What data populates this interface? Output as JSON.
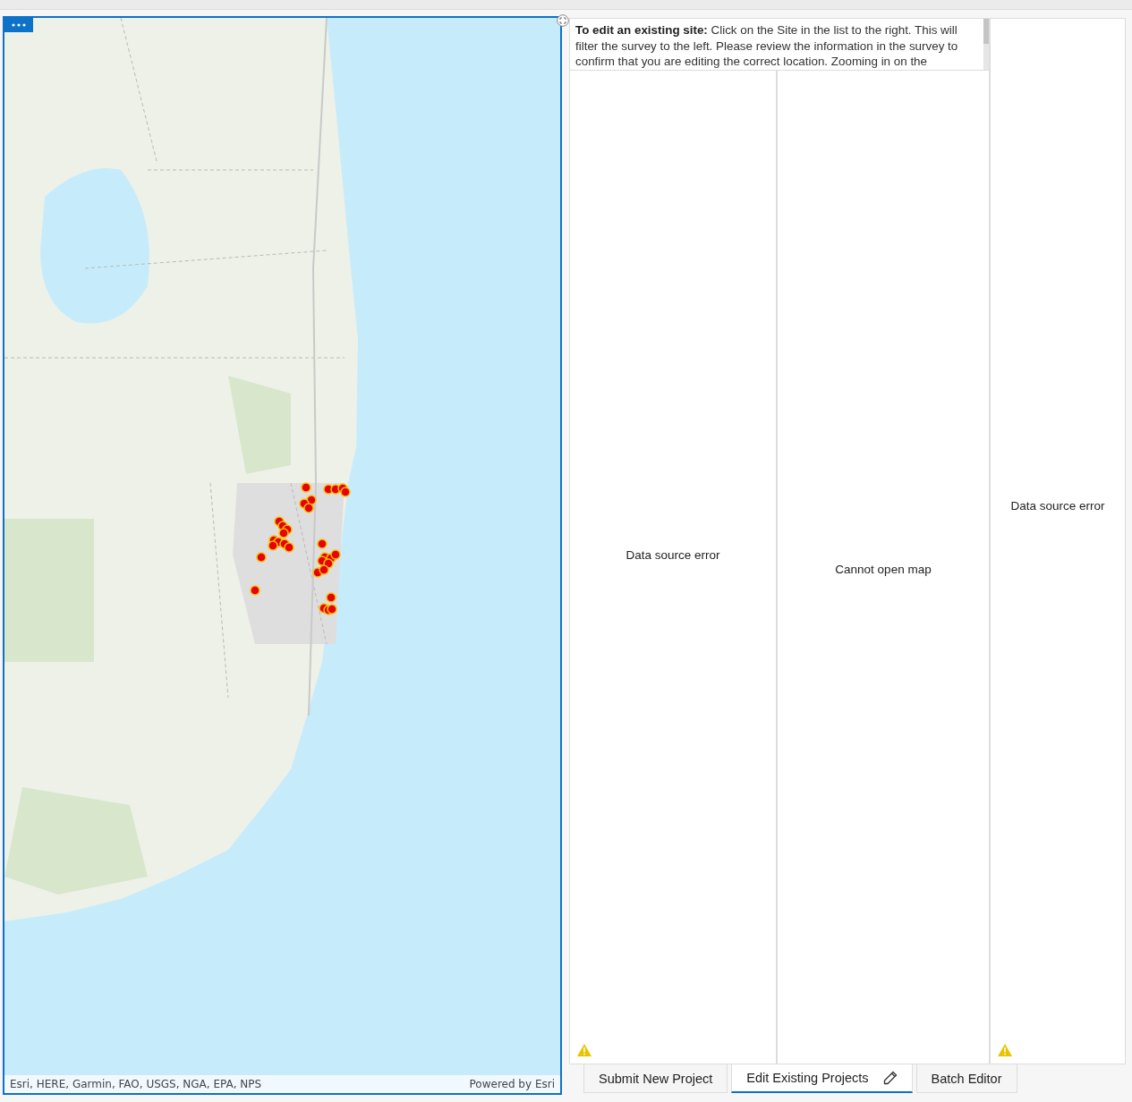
{
  "map": {
    "attribution": "Esri, HERE, Garmin, FAO, USGS, NGA, EPA, NPS",
    "powered_by": "Powered by Esri"
  },
  "instructions": "**To edit an existing site:** Click on the Site in the list to the right. This will filter the survey to the left. Please review the information in the survey to confirm that you are editing the correct location. Zooming in on the",
  "panels": [
    {
      "message": "Data source error",
      "warning": true
    },
    {
      "message": "Cannot open map",
      "warning": false
    },
    {
      "message": "Data source error",
      "warning": true
    }
  ],
  "tabs": [
    {
      "label": "Submit New Project",
      "selected": false,
      "editing": false
    },
    {
      "label": "Edit Existing Projects",
      "selected": true,
      "editing": true
    },
    {
      "label": "Batch Editor",
      "selected": false,
      "editing": false
    }
  ]
}
